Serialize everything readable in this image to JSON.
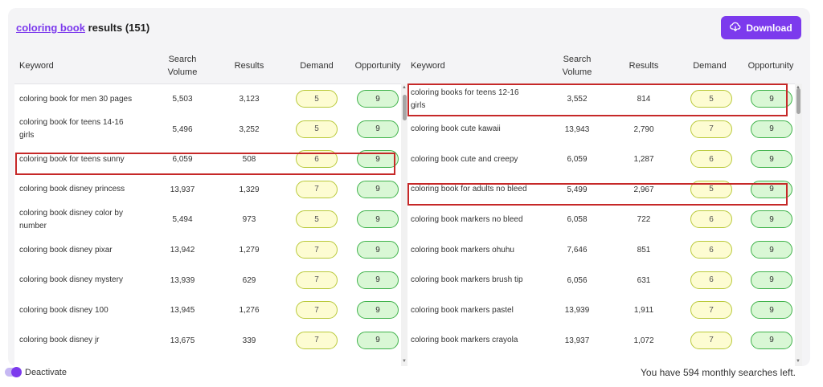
{
  "header": {
    "query": "coloring book",
    "results_suffix": "results (151)",
    "download_label": "Download"
  },
  "columns": {
    "keyword": "Keyword",
    "search_volume_1": "Search",
    "search_volume_2": "Volume",
    "results": "Results",
    "demand": "Demand",
    "opportunity": "Opportunity"
  },
  "left_rows": [
    {
      "keyword": "coloring book for men 30 pages",
      "volume": "5,503",
      "results": "3,123",
      "demand": "5",
      "opportunity": "9"
    },
    {
      "keyword": "coloring book for teens 14-16 girls",
      "volume": "5,496",
      "results": "3,252",
      "demand": "5",
      "opportunity": "9"
    },
    {
      "keyword": "coloring book for teens sunny",
      "volume": "6,059",
      "results": "508",
      "demand": "6",
      "opportunity": "9"
    },
    {
      "keyword": "coloring book disney princess",
      "volume": "13,937",
      "results": "1,329",
      "demand": "7",
      "opportunity": "9"
    },
    {
      "keyword": "coloring book disney color by number",
      "volume": "5,494",
      "results": "973",
      "demand": "5",
      "opportunity": "9"
    },
    {
      "keyword": "coloring book disney pixar",
      "volume": "13,942",
      "results": "1,279",
      "demand": "7",
      "opportunity": "9"
    },
    {
      "keyword": "coloring book disney mystery",
      "volume": "13,939",
      "results": "629",
      "demand": "7",
      "opportunity": "9"
    },
    {
      "keyword": "coloring book disney 100",
      "volume": "13,945",
      "results": "1,276",
      "demand": "7",
      "opportunity": "9"
    },
    {
      "keyword": "coloring book disney jr",
      "volume": "13,675",
      "results": "339",
      "demand": "7",
      "opportunity": "9"
    }
  ],
  "right_rows": [
    {
      "keyword": "coloring books for teens 12-16 girls",
      "volume": "3,552",
      "results": "814",
      "demand": "5",
      "opportunity": "9"
    },
    {
      "keyword": "coloring book cute kawaii",
      "volume": "13,943",
      "results": "2,790",
      "demand": "7",
      "opportunity": "9"
    },
    {
      "keyword": "coloring book cute and creepy",
      "volume": "6,059",
      "results": "1,287",
      "demand": "6",
      "opportunity": "9"
    },
    {
      "keyword": "coloring book for adults no bleed",
      "volume": "5,499",
      "results": "2,967",
      "demand": "5",
      "opportunity": "9"
    },
    {
      "keyword": "coloring book markers no bleed",
      "volume": "6,058",
      "results": "722",
      "demand": "6",
      "opportunity": "9"
    },
    {
      "keyword": "coloring book markers ohuhu",
      "volume": "7,646",
      "results": "851",
      "demand": "6",
      "opportunity": "9"
    },
    {
      "keyword": "coloring book markers brush tip",
      "volume": "6,056",
      "results": "631",
      "demand": "6",
      "opportunity": "9"
    },
    {
      "keyword": "coloring book markers pastel",
      "volume": "13,939",
      "results": "1,911",
      "demand": "7",
      "opportunity": "9"
    },
    {
      "keyword": "coloring book markers crayola",
      "volume": "13,937",
      "results": "1,072",
      "demand": "7",
      "opportunity": "9"
    }
  ],
  "footer": {
    "toggle_label": "Deactivate",
    "searches_left": "You have 594 monthly searches left."
  },
  "colors": {
    "accent": "#7c3aed",
    "highlight": "#c62828",
    "demand_pill": "#fdfcd2",
    "opportunity_pill": "#d9f7d5"
  }
}
